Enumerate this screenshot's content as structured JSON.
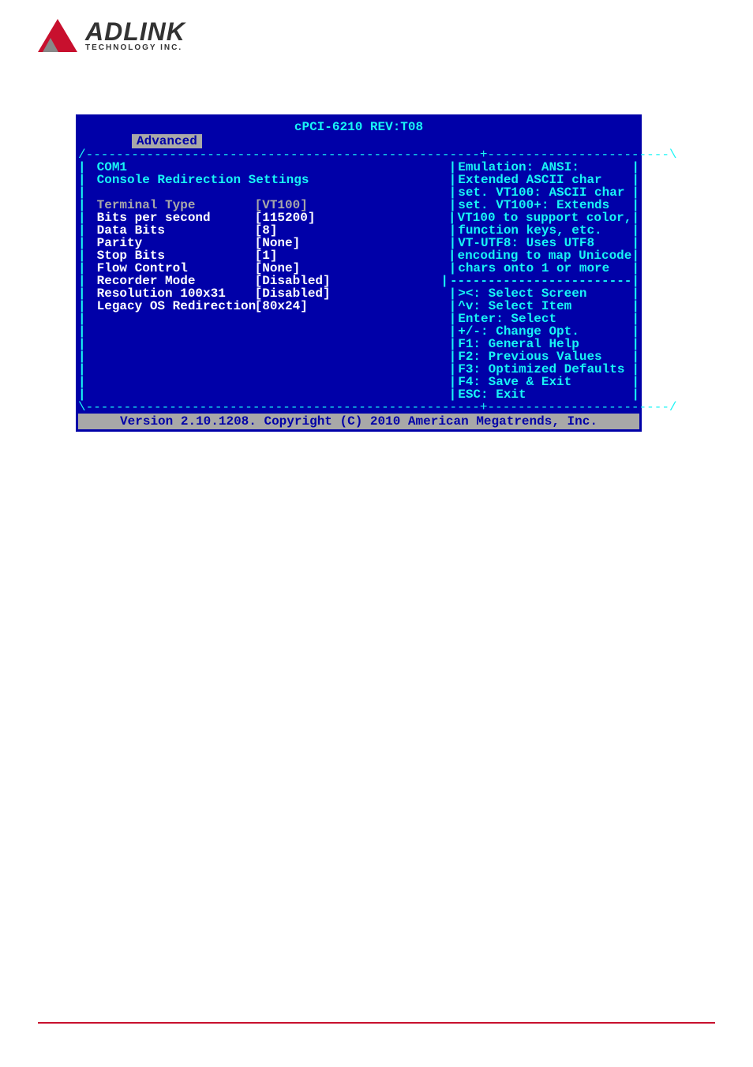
{
  "logo": {
    "brand": "ADLINK",
    "sub": "TECHNOLOGY INC."
  },
  "bios": {
    "title": "cPCI-6210 REV:T08",
    "tab": "Advanced",
    "section": "COM1",
    "subsection": "Console Redirection Settings",
    "settings": [
      {
        "label": "Terminal Type",
        "value": "[VT100]",
        "selected": true
      },
      {
        "label": "Bits per second",
        "value": "[115200]"
      },
      {
        "label": "Data Bits",
        "value": "[8]"
      },
      {
        "label": "Parity",
        "value": "[None]"
      },
      {
        "label": "Stop Bits",
        "value": "[1]"
      },
      {
        "label": "Flow Control",
        "value": "[None]"
      },
      {
        "label": "Recorder Mode",
        "value": "[Disabled]"
      },
      {
        "label": "Resolution 100x31",
        "value": "[Disabled]"
      },
      {
        "label": "Legacy OS Redirection",
        "value": "[80x24]"
      }
    ],
    "help": [
      "Emulation: ANSI:",
      "Extended ASCII char",
      "set. VT100: ASCII char",
      "set. VT100+: Extends",
      "VT100 to support color,",
      "function keys, etc.",
      "VT-UTF8: Uses UTF8",
      "encoding to map Unicode",
      "chars onto 1 or more"
    ],
    "keys": [
      "><: Select Screen",
      "^v: Select Item",
      "Enter: Select",
      "+/-: Change Opt.",
      "F1: General Help",
      "F2: Previous Values",
      "F3: Optimized Defaults",
      "F4: Save & Exit",
      "ESC: Exit"
    ],
    "footer": "Version 2.10.1208. Copyright (C) 2010 American Megatrends, Inc."
  }
}
